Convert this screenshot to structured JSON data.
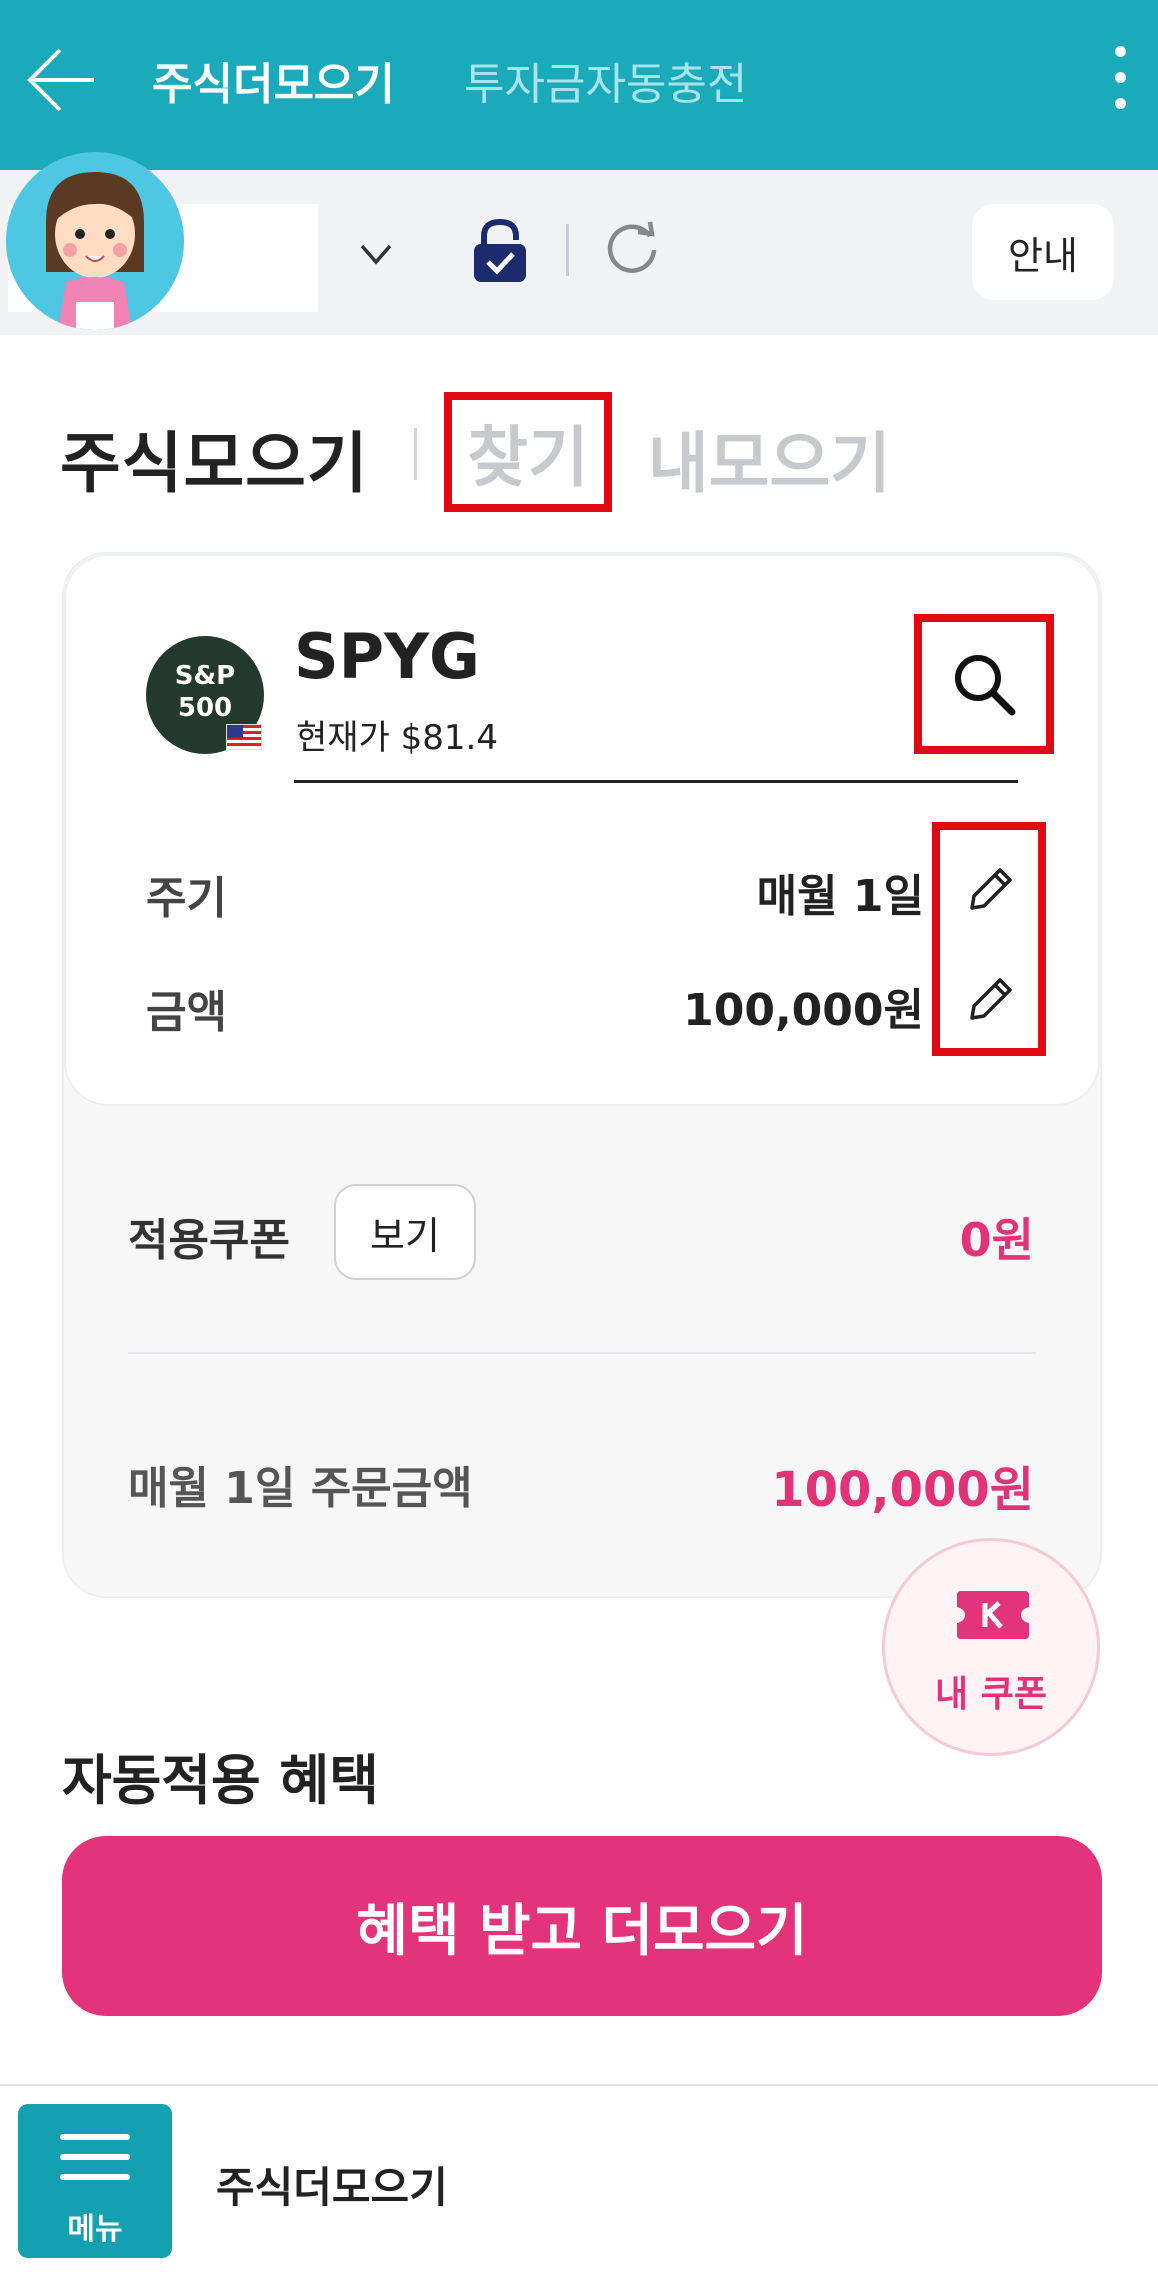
{
  "header": {
    "tab_active": "주식더모으기",
    "tab_inactive": "투자금자동충전"
  },
  "account_bar": {
    "guide_label": "안내"
  },
  "section_tabs": {
    "title": "주식모으기",
    "find": "찾기",
    "mine": "내모으기"
  },
  "stock": {
    "logo_line1": "S&P",
    "logo_line2": "500",
    "ticker": "SPYG",
    "current_price": "현재가 $81.4"
  },
  "settings": {
    "cycle_label": "주기",
    "cycle_value": "매월 1일",
    "amount_label": "금액",
    "amount_value": "100,000원"
  },
  "summary": {
    "coupon_label": "적용쿠폰",
    "view_label": "보기",
    "coupon_value": "0원",
    "order_label": "매월 1일 주문금액",
    "order_value": "100,000원"
  },
  "my_coupon": {
    "label": "내 쿠폰"
  },
  "benefits": {
    "title": "자동적용 혜택",
    "button_label": "혜택 받고 더모으기"
  },
  "bottom_bar": {
    "menu_label": "메뉴",
    "page_title": "주식더모으기"
  },
  "colors": {
    "header_bg": "#1aaab9",
    "accent_pink": "#e3337a",
    "highlight_red": "#e00b12",
    "menu_bg": "#14a0b0"
  }
}
